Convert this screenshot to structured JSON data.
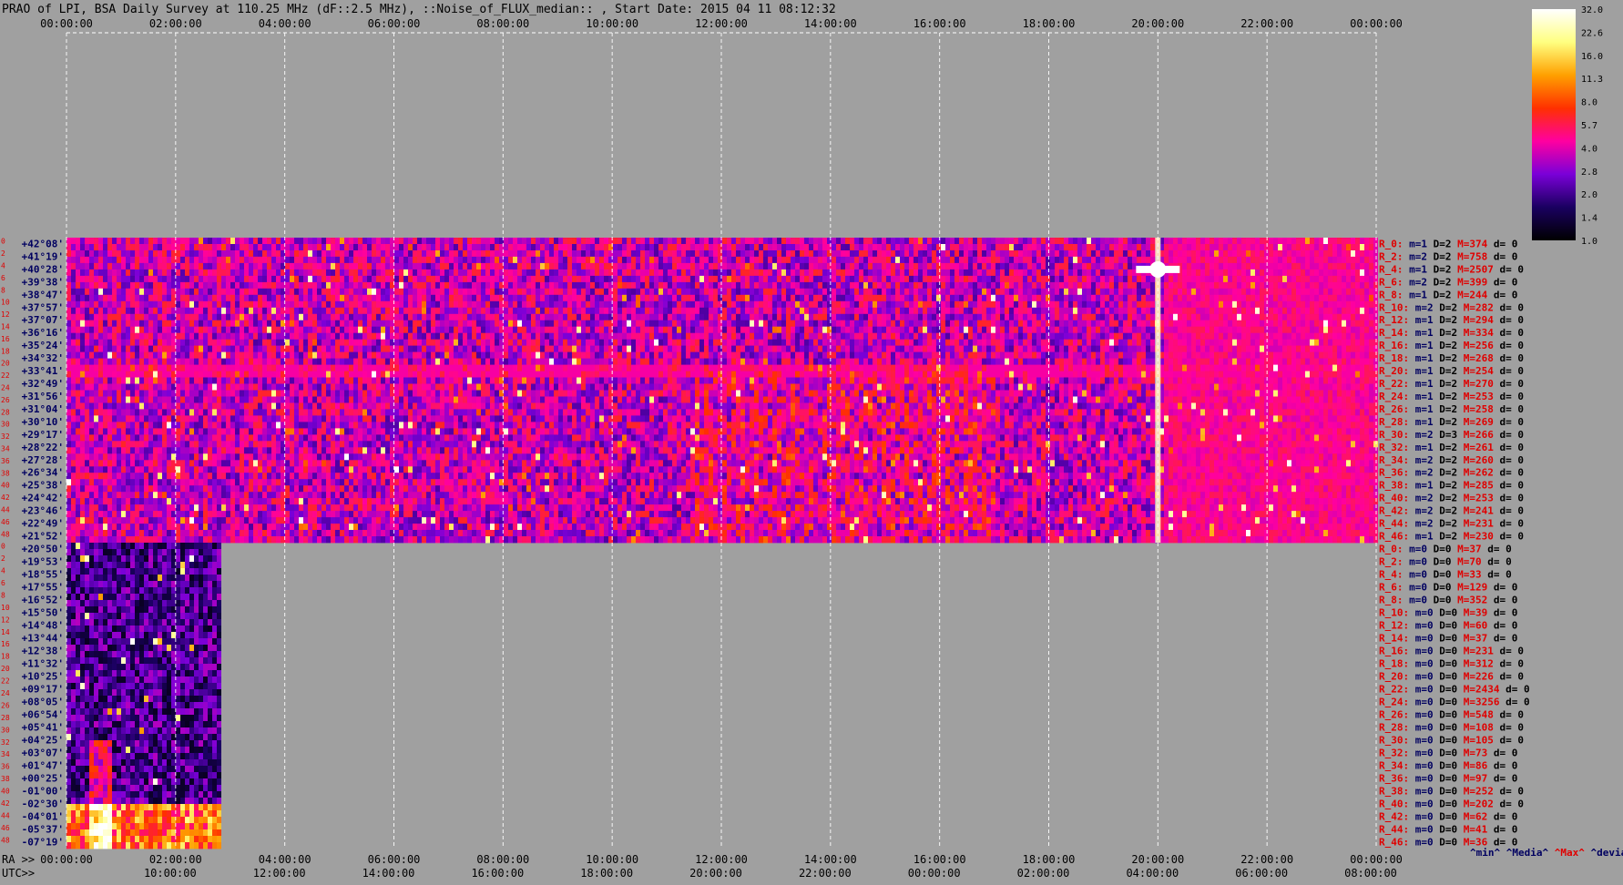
{
  "header": {
    "title": "PRAO of LPI, BSA Daily Survey at 110.25 MHz (dF::2.5 MHz), ::Noise_of_FLUX_median:: , Start Date: 2015 04 11 08:12:32"
  },
  "colors": {
    "background": "#a0a0a0",
    "grid": "#ffffff",
    "label_red": "#e00000",
    "label_navy": "#000060",
    "colormap": [
      "#000000",
      "#1a0060",
      "#7a00d8",
      "#ff00a0",
      "#ff3000",
      "#ffa000",
      "#ffff80",
      "#ffffff"
    ]
  },
  "chart_data": {
    "type": "heatmap",
    "x_axis": {
      "top_ticks": [
        "00:00:00",
        "02:00:00",
        "04:00:00",
        "06:00:00",
        "08:00:00",
        "10:00:00",
        "12:00:00",
        "14:00:00",
        "16:00:00",
        "18:00:00",
        "20:00:00",
        "22:00:00",
        "00:00:00"
      ],
      "bottom_prefix_ra": "RA >>",
      "bottom_ra_ticks": [
        "00:00:00",
        "02:00:00",
        "04:00:00",
        "06:00:00",
        "08:00:00",
        "10:00:00",
        "12:00:00",
        "14:00:00",
        "16:00:00",
        "18:00:00",
        "20:00:00",
        "22:00:00",
        "00:00:00"
      ],
      "bottom_prefix_utc": "UTC>>",
      "bottom_utc_ticks": [
        "10:00:00",
        "12:00:00",
        "14:00:00",
        "16:00:00",
        "18:00:00",
        "20:00:00",
        "22:00:00",
        "00:00:00",
        "02:00:00",
        "04:00:00",
        "06:00:00",
        "08:00:00"
      ]
    },
    "y_axis": {
      "upper_block_labels": [
        "+42°08'",
        "+41°19'",
        "+40°28'",
        "+39°38'",
        "+38°47'",
        "+37°57'",
        "+37°07'",
        "+36°16'",
        "+35°24'",
        "+34°32'",
        "+33°41'",
        "+32°49'",
        "+31°56'",
        "+31°04'",
        "+30°10'",
        "+29°17'",
        "+28°22'",
        "+27°28'",
        "+26°34'",
        "+25°38'",
        "+24°42'",
        "+23°46'",
        "+22°49'",
        "+21°52'"
      ],
      "lower_block_labels": [
        "+20°50'",
        "+19°53'",
        "+18°55'",
        "+17°55'",
        "+16°52'",
        "+15°50'",
        "+14°48'",
        "+13°44'",
        "+12°38'",
        "+11°32'",
        "+10°25'",
        "+09°17'",
        "+08°05'",
        "+06°54'",
        "+05°41'",
        "+04°25'",
        "+03°07'",
        "+01°47'",
        "+00°25'",
        "-01°00'",
        "-02°30'",
        "-04°01'",
        "-05°37'",
        "-07°19'"
      ],
      "beam_numbers": [
        "0",
        "2",
        "4",
        "6",
        "8",
        "10",
        "12",
        "14",
        "16",
        "18",
        "20",
        "22",
        "24",
        "26",
        "28",
        "30",
        "32",
        "34",
        "36",
        "38",
        "40",
        "42",
        "44",
        "46",
        "48"
      ]
    },
    "colorbar": {
      "ticks": [
        "32.0",
        "22.6",
        "16.0",
        "11.3",
        "8.0",
        "5.7",
        "4.0",
        "2.8",
        "2.0",
        "1.4",
        "1.0"
      ]
    },
    "upper_data_extent_hours": [
      0,
      24
    ],
    "lower_data_extent_hours": [
      0,
      2.8
    ],
    "bright_sources": [
      {
        "block": "upper",
        "hour": 20.0,
        "dec": "+40°28'"
      },
      {
        "block": "lower",
        "hour": 1.2,
        "dec": "+09°17'"
      }
    ],
    "stats": {
      "upper": [
        {
          "r": "R_0:",
          "m": "m=1",
          "d": "D=2",
          "mx": "M=374",
          "dv": "d= 0"
        },
        {
          "r": "R_2:",
          "m": "m=2",
          "d": "D=2",
          "mx": "M=758",
          "dv": "d= 0"
        },
        {
          "r": "R_4:",
          "m": "m=1",
          "d": "D=2",
          "mx": "M=2507",
          "dv": "d= 0"
        },
        {
          "r": "R_6:",
          "m": "m=2",
          "d": "D=2",
          "mx": "M=399",
          "dv": "d= 0"
        },
        {
          "r": "R_8:",
          "m": "m=1",
          "d": "D=2",
          "mx": "M=244",
          "dv": "d= 0"
        },
        {
          "r": "R_10:",
          "m": "m=2",
          "d": "D=2",
          "mx": "M=282",
          "dv": "d= 0"
        },
        {
          "r": "R_12:",
          "m": "m=1",
          "d": "D=2",
          "mx": "M=294",
          "dv": "d= 0"
        },
        {
          "r": "R_14:",
          "m": "m=1",
          "d": "D=2",
          "mx": "M=334",
          "dv": "d= 0"
        },
        {
          "r": "R_16:",
          "m": "m=1",
          "d": "D=2",
          "mx": "M=256",
          "dv": "d= 0"
        },
        {
          "r": "R_18:",
          "m": "m=1",
          "d": "D=2",
          "mx": "M=268",
          "dv": "d= 0"
        },
        {
          "r": "R_20:",
          "m": "m=1",
          "d": "D=2",
          "mx": "M=254",
          "dv": "d= 0"
        },
        {
          "r": "R_22:",
          "m": "m=1",
          "d": "D=2",
          "mx": "M=270",
          "dv": "d= 0"
        },
        {
          "r": "R_24:",
          "m": "m=1",
          "d": "D=2",
          "mx": "M=253",
          "dv": "d= 0"
        },
        {
          "r": "R_26:",
          "m": "m=1",
          "d": "D=2",
          "mx": "M=258",
          "dv": "d= 0"
        },
        {
          "r": "R_28:",
          "m": "m=1",
          "d": "D=2",
          "mx": "M=269",
          "dv": "d= 0"
        },
        {
          "r": "R_30:",
          "m": "m=2",
          "d": "D=3",
          "mx": "M=266",
          "dv": "d= 0"
        },
        {
          "r": "R_32:",
          "m": "m=1",
          "d": "D=2",
          "mx": "M=261",
          "dv": "d= 0"
        },
        {
          "r": "R_34:",
          "m": "m=2",
          "d": "D=2",
          "mx": "M=260",
          "dv": "d= 0"
        },
        {
          "r": "R_36:",
          "m": "m=2",
          "d": "D=2",
          "mx": "M=262",
          "dv": "d= 0"
        },
        {
          "r": "R_38:",
          "m": "m=1",
          "d": "D=2",
          "mx": "M=285",
          "dv": "d= 0"
        },
        {
          "r": "R_40:",
          "m": "m=2",
          "d": "D=2",
          "mx": "M=253",
          "dv": "d= 0"
        },
        {
          "r": "R_42:",
          "m": "m=2",
          "d": "D=2",
          "mx": "M=241",
          "dv": "d= 0"
        },
        {
          "r": "R_44:",
          "m": "m=2",
          "d": "D=2",
          "mx": "M=231",
          "dv": "d= 0"
        },
        {
          "r": "R_46:",
          "m": "m=1",
          "d": "D=2",
          "mx": "M=230",
          "dv": "d= 0"
        }
      ],
      "lower": [
        {
          "r": "R_0:",
          "m": "m=0",
          "d": "D=0",
          "mx": "M=37",
          "dv": "d= 0"
        },
        {
          "r": "R_2:",
          "m": "m=0",
          "d": "D=0",
          "mx": "M=70",
          "dv": "d= 0"
        },
        {
          "r": "R_4:",
          "m": "m=0",
          "d": "D=0",
          "mx": "M=33",
          "dv": "d= 0"
        },
        {
          "r": "R_6:",
          "m": "m=0",
          "d": "D=0",
          "mx": "M=129",
          "dv": "d= 0"
        },
        {
          "r": "R_8:",
          "m": "m=0",
          "d": "D=0",
          "mx": "M=352",
          "dv": "d= 0"
        },
        {
          "r": "R_10:",
          "m": "m=0",
          "d": "D=0",
          "mx": "M=39",
          "dv": "d= 0"
        },
        {
          "r": "R_12:",
          "m": "m=0",
          "d": "D=0",
          "mx": "M=60",
          "dv": "d= 0"
        },
        {
          "r": "R_14:",
          "m": "m=0",
          "d": "D=0",
          "mx": "M=37",
          "dv": "d= 0"
        },
        {
          "r": "R_16:",
          "m": "m=0",
          "d": "D=0",
          "mx": "M=231",
          "dv": "d= 0"
        },
        {
          "r": "R_18:",
          "m": "m=0",
          "d": "D=0",
          "mx": "M=312",
          "dv": "d= 0"
        },
        {
          "r": "R_20:",
          "m": "m=0",
          "d": "D=0",
          "mx": "M=226",
          "dv": "d= 0"
        },
        {
          "r": "R_22:",
          "m": "m=0",
          "d": "D=0",
          "mx": "M=2434",
          "dv": "d= 0"
        },
        {
          "r": "R_24:",
          "m": "m=0",
          "d": "D=0",
          "mx": "M=3256",
          "dv": "d= 0"
        },
        {
          "r": "R_26:",
          "m": "m=0",
          "d": "D=0",
          "mx": "M=548",
          "dv": "d= 0"
        },
        {
          "r": "R_28:",
          "m": "m=0",
          "d": "D=0",
          "mx": "M=108",
          "dv": "d= 0"
        },
        {
          "r": "R_30:",
          "m": "m=0",
          "d": "D=0",
          "mx": "M=105",
          "dv": "d= 0"
        },
        {
          "r": "R_32:",
          "m": "m=0",
          "d": "D=0",
          "mx": "M=73",
          "dv": "d= 0"
        },
        {
          "r": "R_34:",
          "m": "m=0",
          "d": "D=0",
          "mx": "M=86",
          "dv": "d= 0"
        },
        {
          "r": "R_36:",
          "m": "m=0",
          "d": "D=0",
          "mx": "M=97",
          "dv": "d= 0"
        },
        {
          "r": "R_38:",
          "m": "m=0",
          "d": "D=0",
          "mx": "M=252",
          "dv": "d= 0"
        },
        {
          "r": "R_40:",
          "m": "m=0",
          "d": "D=0",
          "mx": "M=202",
          "dv": "d= 0"
        },
        {
          "r": "R_42:",
          "m": "m=0",
          "d": "D=0",
          "mx": "M=62",
          "dv": "d= 0"
        },
        {
          "r": "R_44:",
          "m": "m=0",
          "d": "D=0",
          "mx": "M=41",
          "dv": "d= 0"
        },
        {
          "r": "R_46:",
          "m": "m=0",
          "d": "D=0",
          "mx": "M=36",
          "dv": "d= 0"
        }
      ]
    },
    "stats_legend": [
      "^min^",
      "^Media^",
      "^Max^",
      "^devia^"
    ]
  }
}
